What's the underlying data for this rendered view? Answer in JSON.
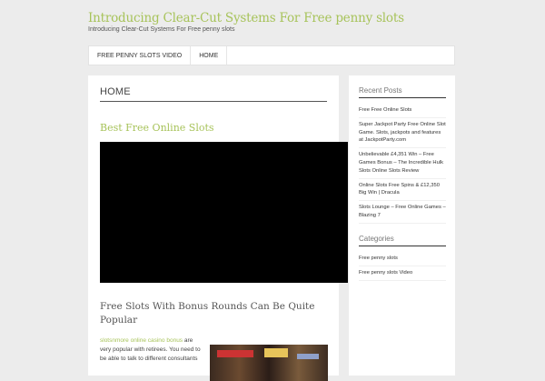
{
  "site": {
    "title": "Introducing Clear-Cut Systems For Free penny slots",
    "description": "Introducing Clear-Cut Systems For Free penny slots"
  },
  "nav": [
    {
      "label": "FREE PENNY SLOTS VIDEO"
    },
    {
      "label": "HOME"
    }
  ],
  "main": {
    "page_title": "HOME",
    "post1_title": "Best Free Online Slots",
    "post2_title": "Free Slots With Bonus Rounds Can Be Quite Popular",
    "body_link": "slotsnmore online casino bonus",
    "body_text": " are very popular with retirees. You need to be able to talk to different consultants"
  },
  "sidebar": {
    "recent_posts_title": "Recent Posts",
    "recent_posts": [
      "Free Free Online Slots",
      "Super Jackpot Party Free Online Slot Game. Slots, jackpots and features at JackpotParty.com",
      "Unbelievable £4,351 Win – Free Games Bonus – The Incredible Hulk Slots Online Slots Review",
      "Online Slots Free Spins & £12,350 Big Win | Dracula",
      "Slots Lounge – Free Online Games – Blazing 7"
    ],
    "categories_title": "Categories",
    "categories": [
      "Free penny slots",
      "Free penny slots Video"
    ]
  },
  "colors": {
    "accent": "#a7c35a",
    "background": "#ececec",
    "panel": "#ffffff"
  }
}
